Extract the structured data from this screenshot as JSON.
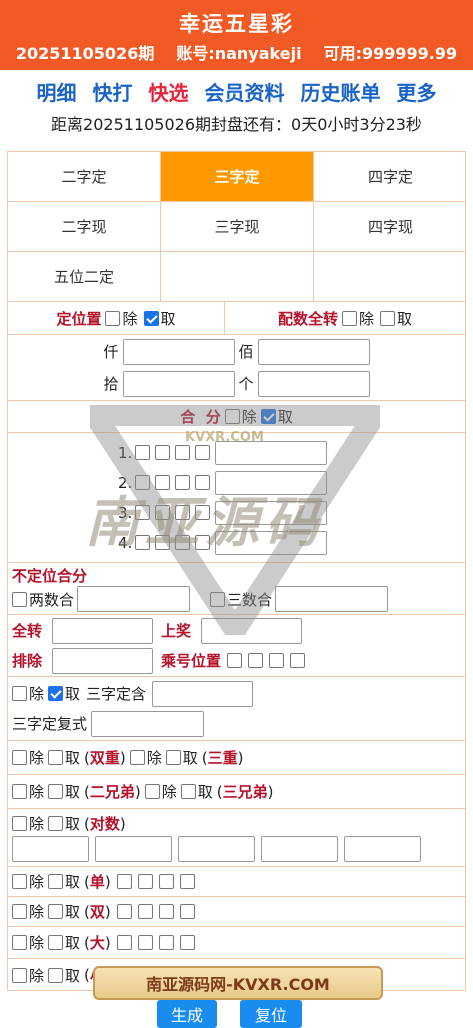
{
  "header": {
    "title": "幸运五星彩",
    "period": "20251105026期",
    "account": "账号:nanyakeji",
    "available": "可用:999999.99"
  },
  "nav": [
    "明细",
    "快打",
    "快选",
    "会员资料",
    "历史账单",
    "更多"
  ],
  "countdown": "距离20251105026期封盘还有：0天0小时3分23秒",
  "tabs": [
    "二字定",
    "三字定",
    "四字定",
    "二字现",
    "三字现",
    "四字现",
    "五位二定",
    ""
  ],
  "selected_tab": "三字定",
  "position": {
    "label": "定位置",
    "exclude": "除",
    "take": "取",
    "pair_label": "配数全转",
    "digits": [
      "仟",
      "佰",
      "拾",
      "个"
    ]
  },
  "sum": {
    "label": "合  分",
    "exclude": "除",
    "take": "取",
    "rows": [
      "1.",
      "2.",
      "3.",
      "4."
    ]
  },
  "unfixed": {
    "label": "不定位合分",
    "two": "两数合",
    "three": "三数合"
  },
  "misc": {
    "all_turn": "全转",
    "award": "上奖",
    "exclude": "排除",
    "mult_pos": "乘号位置"
  },
  "filters": {
    "exclude": "除",
    "take": "取",
    "three_contain": "三字定含",
    "three_compound": "三字定复式",
    "double": "双重",
    "triple": "三重",
    "two_brothers": "二兄弟",
    "three_brothers": "三兄弟",
    "pairs": "对数",
    "odd": "单",
    "even": "双",
    "big": "大",
    "small": "小"
  },
  "watermark": {
    "main": "南亚源码",
    "sub": "KVXR.COM",
    "banner": "南亚源码网-KVXR.COM"
  },
  "buttons": {
    "generate": "生成",
    "reset": "复位"
  },
  "colors": {
    "header": "#f15a24",
    "nav": "#1a63c6",
    "nav_active": "#e8233a",
    "tab_selected": "#ff9900",
    "label": "#b5122c"
  }
}
